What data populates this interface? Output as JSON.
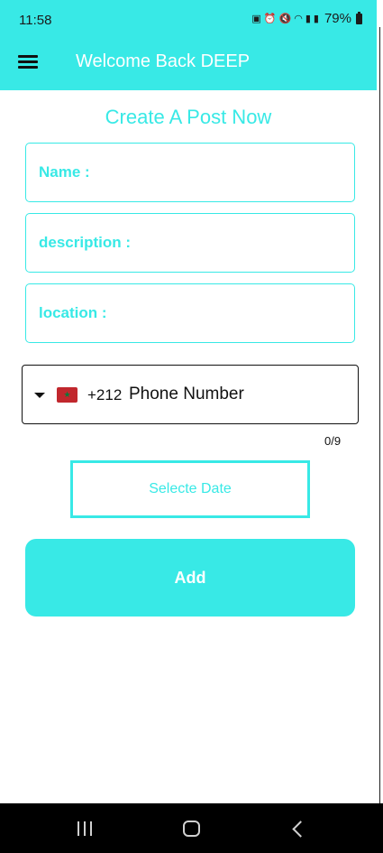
{
  "status_bar": {
    "time": "11:58",
    "battery": "79%",
    "icons": [
      "nfc-icon",
      "alarm-icon",
      "mute-icon",
      "wifi-icon",
      "signal-icon",
      "signal-icon",
      "battery-icon"
    ]
  },
  "app_bar": {
    "menu_icon": "hamburger-menu-icon",
    "title": "Welcome Back DEEP"
  },
  "form": {
    "heading": "Create A Post Now",
    "name_placeholder": "Name :",
    "description_placeholder": "description :",
    "location_placeholder": "location :",
    "phone": {
      "dropdown_icon": "caret-down-icon",
      "flag_icon": "morocco-flag-icon",
      "country_code": "+212",
      "placeholder": "Phone Number",
      "counter": "0/9"
    },
    "date_button_label": "Selecte Date",
    "add_button_label": "Add"
  },
  "nav_bar": {
    "icons": [
      "recents-icon",
      "home-icon",
      "back-icon"
    ]
  },
  "colors": {
    "accent": "#38e9e6",
    "text_dark": "#111111",
    "nav_bg": "#000000"
  }
}
